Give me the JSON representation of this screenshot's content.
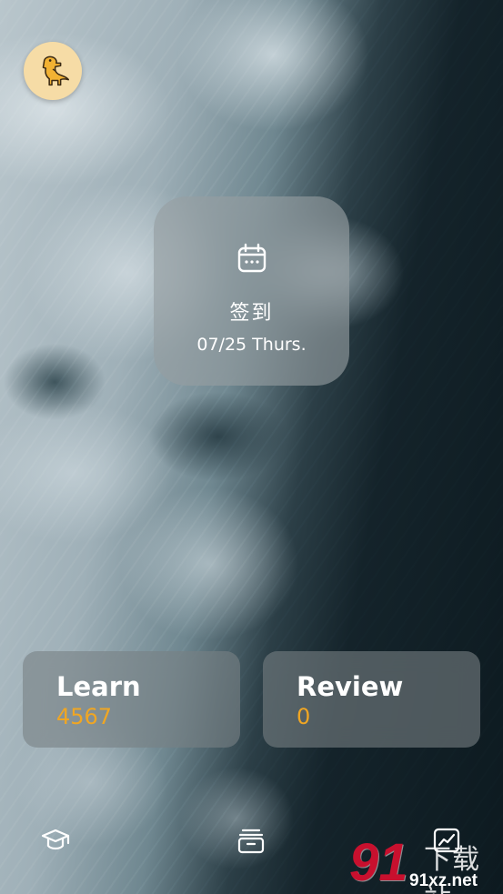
{
  "avatar": {
    "icon": "dinosaur-icon",
    "color": "#f6dca6"
  },
  "checkin": {
    "icon": "calendar-icon",
    "title": "签到",
    "date": "07/25 Thurs."
  },
  "stats": {
    "learn": {
      "label": "Learn",
      "value": "4567"
    },
    "review": {
      "label": "Review",
      "value": "0"
    },
    "value_color": "#f0a623"
  },
  "bottom_nav": {
    "items": [
      {
        "icon": "graduation-cap-icon"
      },
      {
        "icon": "card-stack-icon"
      },
      {
        "icon": "trend-chart-icon"
      }
    ]
  },
  "watermark": {
    "logo": "91",
    "cn": "下载站",
    "url": "91xz.net"
  }
}
